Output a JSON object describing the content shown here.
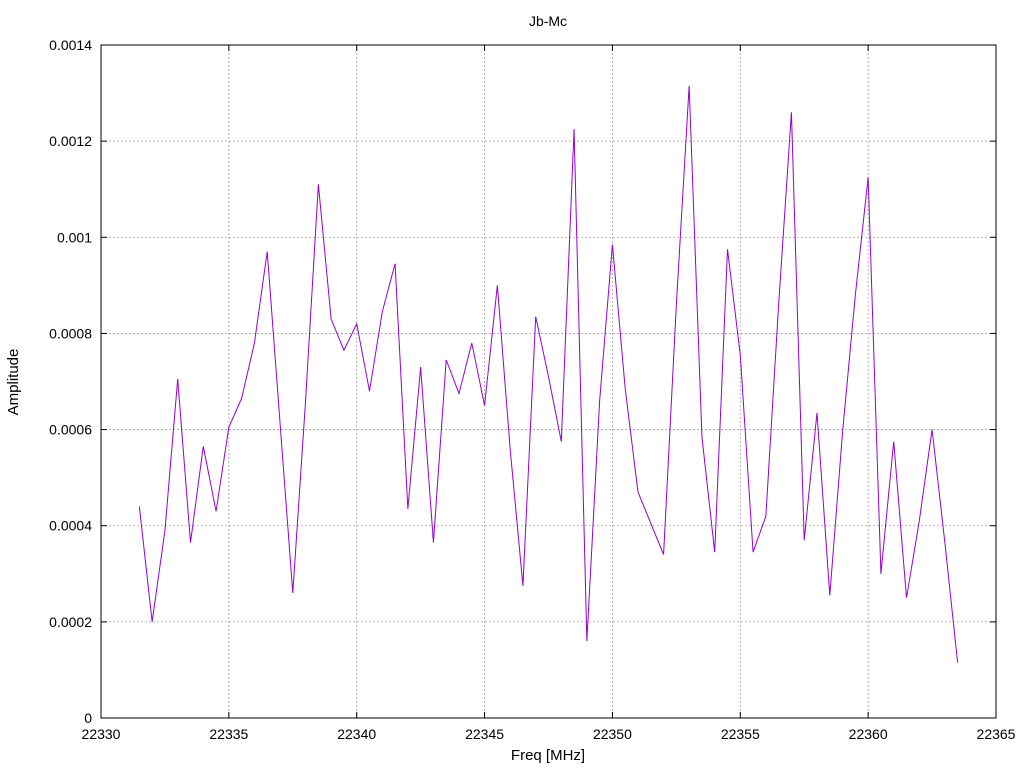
{
  "chart_data": {
    "type": "line",
    "title": "Jb-Mc",
    "xlabel": "Freq [MHz]",
    "ylabel": "Amplitude",
    "xlim": [
      22330,
      22365
    ],
    "ylim": [
      0,
      0.0014
    ],
    "xticks": [
      22330,
      22335,
      22340,
      22345,
      22350,
      22355,
      22360,
      22365
    ],
    "xtick_labels": [
      "22330",
      "22335",
      "22340",
      "22345",
      "22350",
      "22355",
      "22360",
      "22365"
    ],
    "yticks": [
      0,
      0.0002,
      0.0004,
      0.0006,
      0.0008,
      0.001,
      0.0012,
      0.0014
    ],
    "ytick_labels": [
      "0",
      "0.0002",
      "0.0004",
      "0.0006",
      "0.0008",
      "0.001",
      "0.0012",
      "0.0014"
    ],
    "grid": true,
    "legend": "none",
    "series_color": "#9400d3",
    "series": [
      {
        "x": [
          22331.5,
          22332,
          22332.5,
          22333,
          22333.5,
          22334,
          22334.5,
          22335,
          22335.5,
          22336,
          22336.5,
          22337,
          22337.5,
          22338,
          22338.5,
          22339,
          22339.5,
          22340,
          22340.5,
          22341,
          22341.5,
          22342,
          22342.5,
          22343,
          22343.5,
          22344,
          22344.5,
          22345,
          22345.5,
          22346,
          22346.5,
          22347,
          22347.5,
          22348,
          22348.5,
          22349,
          22349.5,
          22350,
          22350.5,
          22351,
          22351.5,
          22352,
          22352.5,
          22353,
          22353.5,
          22354,
          22354.5,
          22355,
          22355.5,
          22356,
          22356.5,
          22357,
          22357.5,
          22358,
          22358.5,
          22359,
          22359.5,
          22360,
          22360.5,
          22361,
          22361.5,
          22362,
          22362.5,
          22363,
          22363.5
        ],
        "y": [
          0.00044,
          0.0002,
          0.00039,
          0.000705,
          0.000365,
          0.000565,
          0.00043,
          0.000605,
          0.000665,
          0.00078,
          0.00097,
          0.000615,
          0.00026,
          0.00066,
          0.00111,
          0.00083,
          0.000765,
          0.00082,
          0.00068,
          0.000845,
          0.000945,
          0.000435,
          0.00073,
          0.000365,
          0.000745,
          0.000675,
          0.00078,
          0.00065,
          0.0009,
          0.00056,
          0.000275,
          0.000835,
          0.00071,
          0.000575,
          0.001225,
          0.00016,
          0.00066,
          0.000985,
          0.000685,
          0.00047,
          0.000405,
          0.00034,
          0.00086,
          0.001315,
          0.000585,
          0.000345,
          0.000975,
          0.000755,
          0.000345,
          0.00042,
          0.00086,
          0.00126,
          0.00037,
          0.000635,
          0.000255,
          0.000595,
          0.00088,
          0.001125,
          0.0003,
          0.000575,
          0.00025,
          0.00041,
          0.0006,
          0.000365,
          0.000115
        ]
      }
    ]
  }
}
